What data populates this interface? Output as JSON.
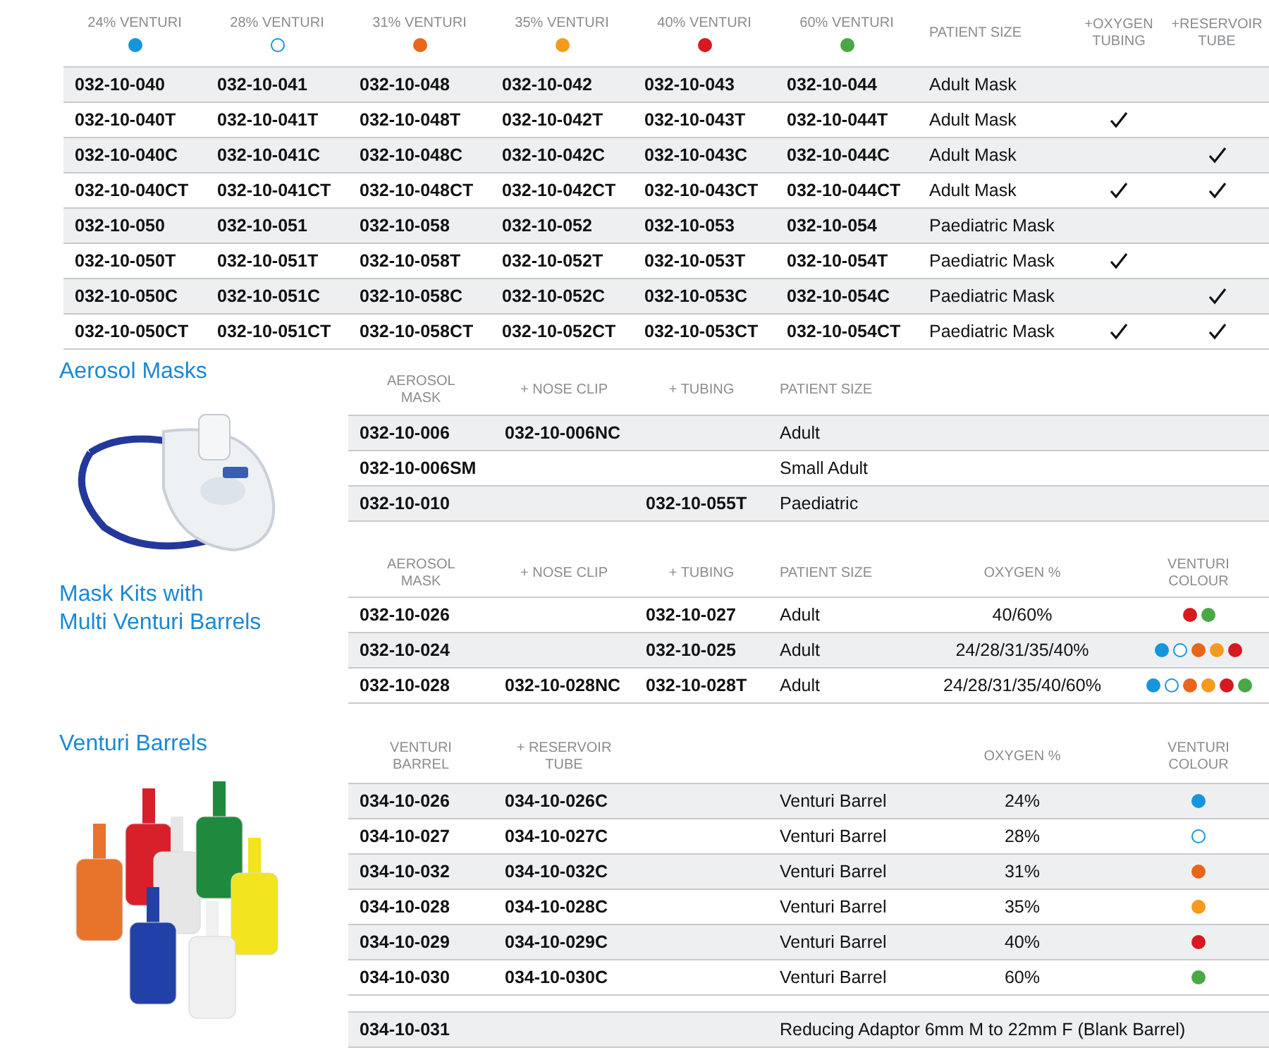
{
  "main_table": {
    "venturi_columns": [
      {
        "label": "24% VENTURI",
        "color": "#1795dc",
        "hollow": false
      },
      {
        "label": "28% VENTURI",
        "color": "#1795dc",
        "hollow": true
      },
      {
        "label": "31% VENTURI",
        "color": "#e8661c",
        "hollow": false
      },
      {
        "label": "35% VENTURI",
        "color": "#f49b1e",
        "hollow": false
      },
      {
        "label": "40% VENTURI",
        "color": "#d81920",
        "hollow": false
      },
      {
        "label": "60% VENTURI",
        "color": "#4aa844",
        "hollow": false
      }
    ],
    "patient_size_label": "PATIENT SIZE",
    "oxygen_tubing_label": "+OXYGEN TUBING",
    "reservoir_tube_label": "+RESERVOIR TUBE",
    "rows": [
      {
        "codes": [
          "032-10-040",
          "032-10-041",
          "032-10-048",
          "032-10-042",
          "032-10-043",
          "032-10-044"
        ],
        "patient_size": "Adult Mask",
        "oxygen_tubing": false,
        "reservoir_tube": false
      },
      {
        "codes": [
          "032-10-040T",
          "032-10-041T",
          "032-10-048T",
          "032-10-042T",
          "032-10-043T",
          "032-10-044T"
        ],
        "patient_size": "Adult Mask",
        "oxygen_tubing": true,
        "reservoir_tube": false
      },
      {
        "codes": [
          "032-10-040C",
          "032-10-041C",
          "032-10-048C",
          "032-10-042C",
          "032-10-043C",
          "032-10-044C"
        ],
        "patient_size": "Adult Mask",
        "oxygen_tubing": false,
        "reservoir_tube": true
      },
      {
        "codes": [
          "032-10-040CT",
          "032-10-041CT",
          "032-10-048CT",
          "032-10-042CT",
          "032-10-043CT",
          "032-10-044CT"
        ],
        "patient_size": "Adult Mask",
        "oxygen_tubing": true,
        "reservoir_tube": true
      },
      {
        "codes": [
          "032-10-050",
          "032-10-051",
          "032-10-058",
          "032-10-052",
          "032-10-053",
          "032-10-054"
        ],
        "patient_size": "Paediatric Mask",
        "oxygen_tubing": false,
        "reservoir_tube": false
      },
      {
        "codes": [
          "032-10-050T",
          "032-10-051T",
          "032-10-058T",
          "032-10-052T",
          "032-10-053T",
          "032-10-054T"
        ],
        "patient_size": "Paediatric Mask",
        "oxygen_tubing": true,
        "reservoir_tube": false
      },
      {
        "codes": [
          "032-10-050C",
          "032-10-051C",
          "032-10-058C",
          "032-10-052C",
          "032-10-053C",
          "032-10-054C"
        ],
        "patient_size": "Paediatric Mask",
        "oxygen_tubing": false,
        "reservoir_tube": true
      },
      {
        "codes": [
          "032-10-050CT",
          "032-10-051CT",
          "032-10-058CT",
          "032-10-052CT",
          "032-10-053CT",
          "032-10-054CT"
        ],
        "patient_size": "Paediatric Mask",
        "oxygen_tubing": true,
        "reservoir_tube": true
      }
    ]
  },
  "aerosol_masks": {
    "title": "Aerosol Masks",
    "columns": [
      "AEROSOL MASK",
      "+ NOSE CLIP",
      "+ TUBING",
      "PATIENT SIZE"
    ],
    "rows": [
      {
        "aerosol_mask": "032-10-006",
        "nose_clip": "032-10-006NC",
        "patient_size": "Adult"
      },
      {
        "aerosol_mask": "032-10-006SM",
        "patient_size": "Small Adult"
      },
      {
        "aerosol_mask": "032-10-010",
        "tubing": "032-10-055T",
        "patient_size": "Paediatric"
      }
    ]
  },
  "mask_kits": {
    "title_lines": [
      "Mask Kits with",
      "Multi Venturi Barrels"
    ],
    "columns": [
      "AEROSOL MASK",
      "+ NOSE CLIP",
      "+ TUBING",
      "PATIENT SIZE",
      "OXYGEN %",
      "VENTURI COLOUR"
    ],
    "rows": [
      {
        "aerosol_mask": "032-10-026",
        "tubing": "032-10-027",
        "patient_size": "Adult",
        "oxygen": "40/60%",
        "venturi_colours": [
          {
            "color": "#d81920",
            "hollow": false
          },
          {
            "color": "#4aa844",
            "hollow": false
          }
        ]
      },
      {
        "aerosol_mask": "032-10-024",
        "tubing": "032-10-025",
        "patient_size": "Adult",
        "oxygen": "24/28/31/35/40%",
        "venturi_colours": [
          {
            "color": "#1795dc",
            "hollow": false
          },
          {
            "color": "#1795dc",
            "hollow": true
          },
          {
            "color": "#e8661c",
            "hollow": false
          },
          {
            "color": "#f49b1e",
            "hollow": false
          },
          {
            "color": "#d81920",
            "hollow": false
          }
        ]
      },
      {
        "aerosol_mask": "032-10-028",
        "nose_clip": "032-10-028NC",
        "tubing": "032-10-028T",
        "patient_size": "Adult",
        "oxygen": "24/28/31/35/40/60%",
        "venturi_colours": [
          {
            "color": "#1795dc",
            "hollow": false
          },
          {
            "color": "#1795dc",
            "hollow": true
          },
          {
            "color": "#e8661c",
            "hollow": false
          },
          {
            "color": "#f49b1e",
            "hollow": false
          },
          {
            "color": "#d81920",
            "hollow": false
          },
          {
            "color": "#4aa844",
            "hollow": false
          }
        ]
      }
    ]
  },
  "venturi_barrels": {
    "title": "Venturi Barrels",
    "columns": [
      "VENTURI BARREL",
      "+ RESERVOIR TUBE",
      "OXYGEN %",
      "VENTURI COLOUR"
    ],
    "rows": [
      {
        "venturi_barrel": "034-10-026",
        "reservoir_tube": "034-10-026C",
        "description": "Venturi Barrel",
        "oxygen": "24%",
        "venturi_colour": {
          "color": "#1795dc",
          "hollow": false
        }
      },
      {
        "venturi_barrel": "034-10-027",
        "reservoir_tube": "034-10-027C",
        "description": "Venturi Barrel",
        "oxygen": "28%",
        "venturi_colour": {
          "color": "#1795dc",
          "hollow": true
        }
      },
      {
        "venturi_barrel": "034-10-032",
        "reservoir_tube": "034-10-032C",
        "description": "Venturi Barrel",
        "oxygen": "31%",
        "venturi_colour": {
          "color": "#e8661c",
          "hollow": false
        }
      },
      {
        "venturi_barrel": "034-10-028",
        "reservoir_tube": "034-10-028C",
        "description": "Venturi Barrel",
        "oxygen": "35%",
        "venturi_colour": {
          "color": "#f49b1e",
          "hollow": false
        }
      },
      {
        "venturi_barrel": "034-10-029",
        "reservoir_tube": "034-10-029C",
        "description": "Venturi Barrel",
        "oxygen": "40%",
        "venturi_colour": {
          "color": "#d81920",
          "hollow": false
        }
      },
      {
        "venturi_barrel": "034-10-030",
        "reservoir_tube": "034-10-030C",
        "description": "Venturi Barrel",
        "oxygen": "60%",
        "venturi_colour": {
          "color": "#4aa844",
          "hollow": false
        }
      }
    ],
    "adaptor": {
      "code": "034-10-031",
      "description": "Reducing Adaptor 6mm M to 22mm F (Blank Barrel)"
    }
  }
}
